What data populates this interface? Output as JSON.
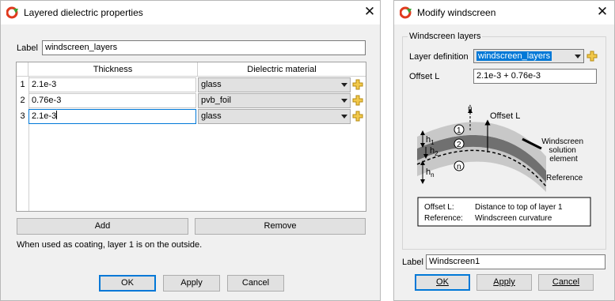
{
  "left_dialog": {
    "title": "Layered dielectric properties",
    "label_caption": "Label",
    "label_value": "windscreen_layers",
    "columns": [
      "Thickness",
      "Dielectric material"
    ],
    "rows": [
      {
        "num": "1",
        "thickness": "2.1e-3",
        "material": "glass"
      },
      {
        "num": "2",
        "thickness": "0.76e-3",
        "material": "pvb_foil"
      },
      {
        "num": "3",
        "thickness": "2.1e-3",
        "material": "glass"
      }
    ],
    "add_label": "Add",
    "remove_label": "Remove",
    "note": "When used as coating, layer 1 is on the outside.",
    "ok_label": "OK",
    "apply_label": "Apply",
    "cancel_label": "Cancel"
  },
  "right_dialog": {
    "title": "Modify windscreen",
    "group_title": "Windscreen layers",
    "layer_def_caption": "Layer definition",
    "layer_def_value": "windscreen_layers",
    "offset_caption": "Offset L",
    "offset_value": "2.1e-3 + 0.76e-3",
    "diagram": {
      "normal": "n̂",
      "offset_label": "Offset L",
      "h1": "h",
      "h1_sub": "1",
      "h2": "h",
      "h2_sub": "2",
      "hn": "h",
      "hn_sub": "n",
      "layer1": "1",
      "layer2": "2",
      "layern": "n",
      "solution_element": [
        "Windscreen",
        "solution",
        "element"
      ],
      "reference": "Reference",
      "legend_rows": [
        {
          "key": "Offset L:",
          "value": "Distance to top of layer 1"
        },
        {
          "key": "Reference:",
          "value": "Windscreen curvature"
        }
      ]
    },
    "label_caption": "Label",
    "label_value": "Windscreen1",
    "ok_label": "OK",
    "apply_label": "Apply",
    "cancel_label": "Cancel"
  },
  "colors": {
    "accent": "#0078d7",
    "dialog_bg": "#f0f0f0",
    "layer_dark": "#6e6e6e",
    "layer_light": "#c8c8c8"
  },
  "icons": [
    "app-icon",
    "close-icon",
    "add-material-icon",
    "dropdown-arrow-icon"
  ]
}
